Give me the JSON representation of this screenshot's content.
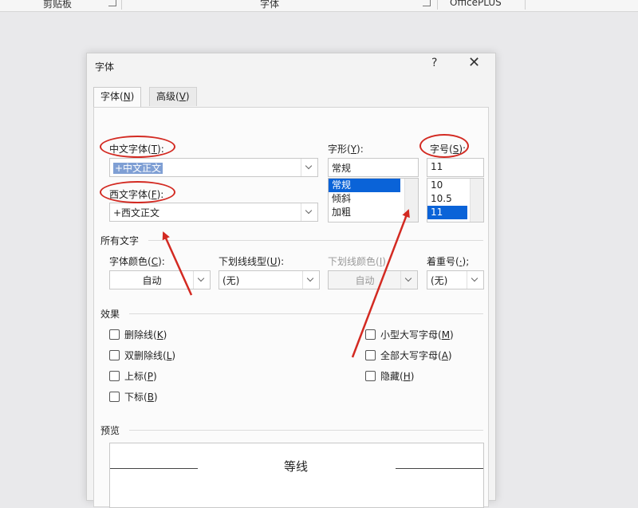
{
  "ribbon": {
    "groups": [
      "剪贴板",
      "字体",
      "OfficePLUS"
    ]
  },
  "dialog": {
    "title": "字体",
    "help": "?",
    "close": "✕",
    "tabs": [
      {
        "label": "字体(",
        "key": "N",
        "suffix": ")"
      },
      {
        "label": "高级(",
        "key": "V",
        "suffix": ")"
      }
    ],
    "chinese_font": {
      "label": "中文字体(",
      "key": "T",
      "suffix": "):",
      "value": "+中文正文"
    },
    "western_font": {
      "label": "西文字体(",
      "key": "F",
      "suffix": "):",
      "value": "+西文正文"
    },
    "style": {
      "label": "字形(",
      "key": "Y",
      "suffix": "):",
      "value": "常规",
      "options": [
        "常规",
        "倾斜",
        "加粗"
      ],
      "selected_index": 0
    },
    "size": {
      "label": "字号(",
      "key": "S",
      "suffix": "):",
      "value": "11",
      "options": [
        "10",
        "10.5",
        "11"
      ],
      "selected_index": 2
    },
    "all_text": {
      "title": "所有文字",
      "font_color": {
        "label": "字体颜色(",
        "key": "C",
        "suffix": "):",
        "value": "自动"
      },
      "underline_type": {
        "label": "下划线线型(",
        "key": "U",
        "suffix": "):",
        "value": "(无)"
      },
      "underline_color": {
        "label": "下划线颜色(",
        "key": "I",
        "suffix": ")",
        "value": "自动"
      },
      "emphasis": {
        "label": "着重号(",
        "key": "·",
        "suffix": ");",
        "value": "(无)"
      }
    },
    "effects": {
      "title": "效果",
      "left": [
        {
          "label": "删除线(",
          "key": "K",
          "suffix": ")"
        },
        {
          "label": "双删除线(",
          "key": "L",
          "suffix": ")"
        },
        {
          "label": "上标(",
          "key": "P",
          "suffix": ")"
        },
        {
          "label": "下标(",
          "key": "B",
          "suffix": ")"
        }
      ],
      "right": [
        {
          "label": "小型大写字母(",
          "key": "M",
          "suffix": ")"
        },
        {
          "label": "全部大写字母(",
          "key": "A",
          "suffix": ")"
        },
        {
          "label": "隐藏(",
          "key": "H",
          "suffix": ")"
        }
      ]
    },
    "preview": {
      "title": "预览",
      "text": "等线"
    }
  },
  "annotation_color": "#d32a22"
}
